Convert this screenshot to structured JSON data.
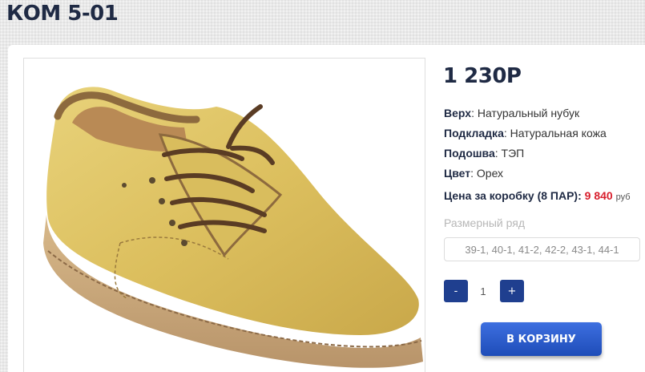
{
  "product": {
    "title": "КОМ 5-01",
    "price": "1 230Р",
    "specs": [
      {
        "label": "Верх",
        "value": ": Натуральный нубук"
      },
      {
        "label": "Подкладка",
        "value": ": Натуральная кожа"
      },
      {
        "label": "Подошва",
        "value": ": ТЭП"
      },
      {
        "label": "Цвет",
        "value": ": Орех"
      }
    ],
    "box_price": {
      "label": "Цена за коробку (8 ПАР):",
      "value": "9 840",
      "currency": "руб"
    },
    "sizes": {
      "caption": "Размерный ряд",
      "value": "39-1, 40-1, 41-2, 42-2, 43-1, 44-1"
    },
    "image": {
      "icon": "shoe-photo",
      "alt": ""
    }
  },
  "quantity": {
    "minus_label": "-",
    "value": "1",
    "plus_label": "+"
  },
  "cart_button_label": "В КОРЗИНУ",
  "colors": {
    "accent": "#1f3f8f",
    "price_red": "#d81e2c",
    "title": "#1f2a44"
  }
}
